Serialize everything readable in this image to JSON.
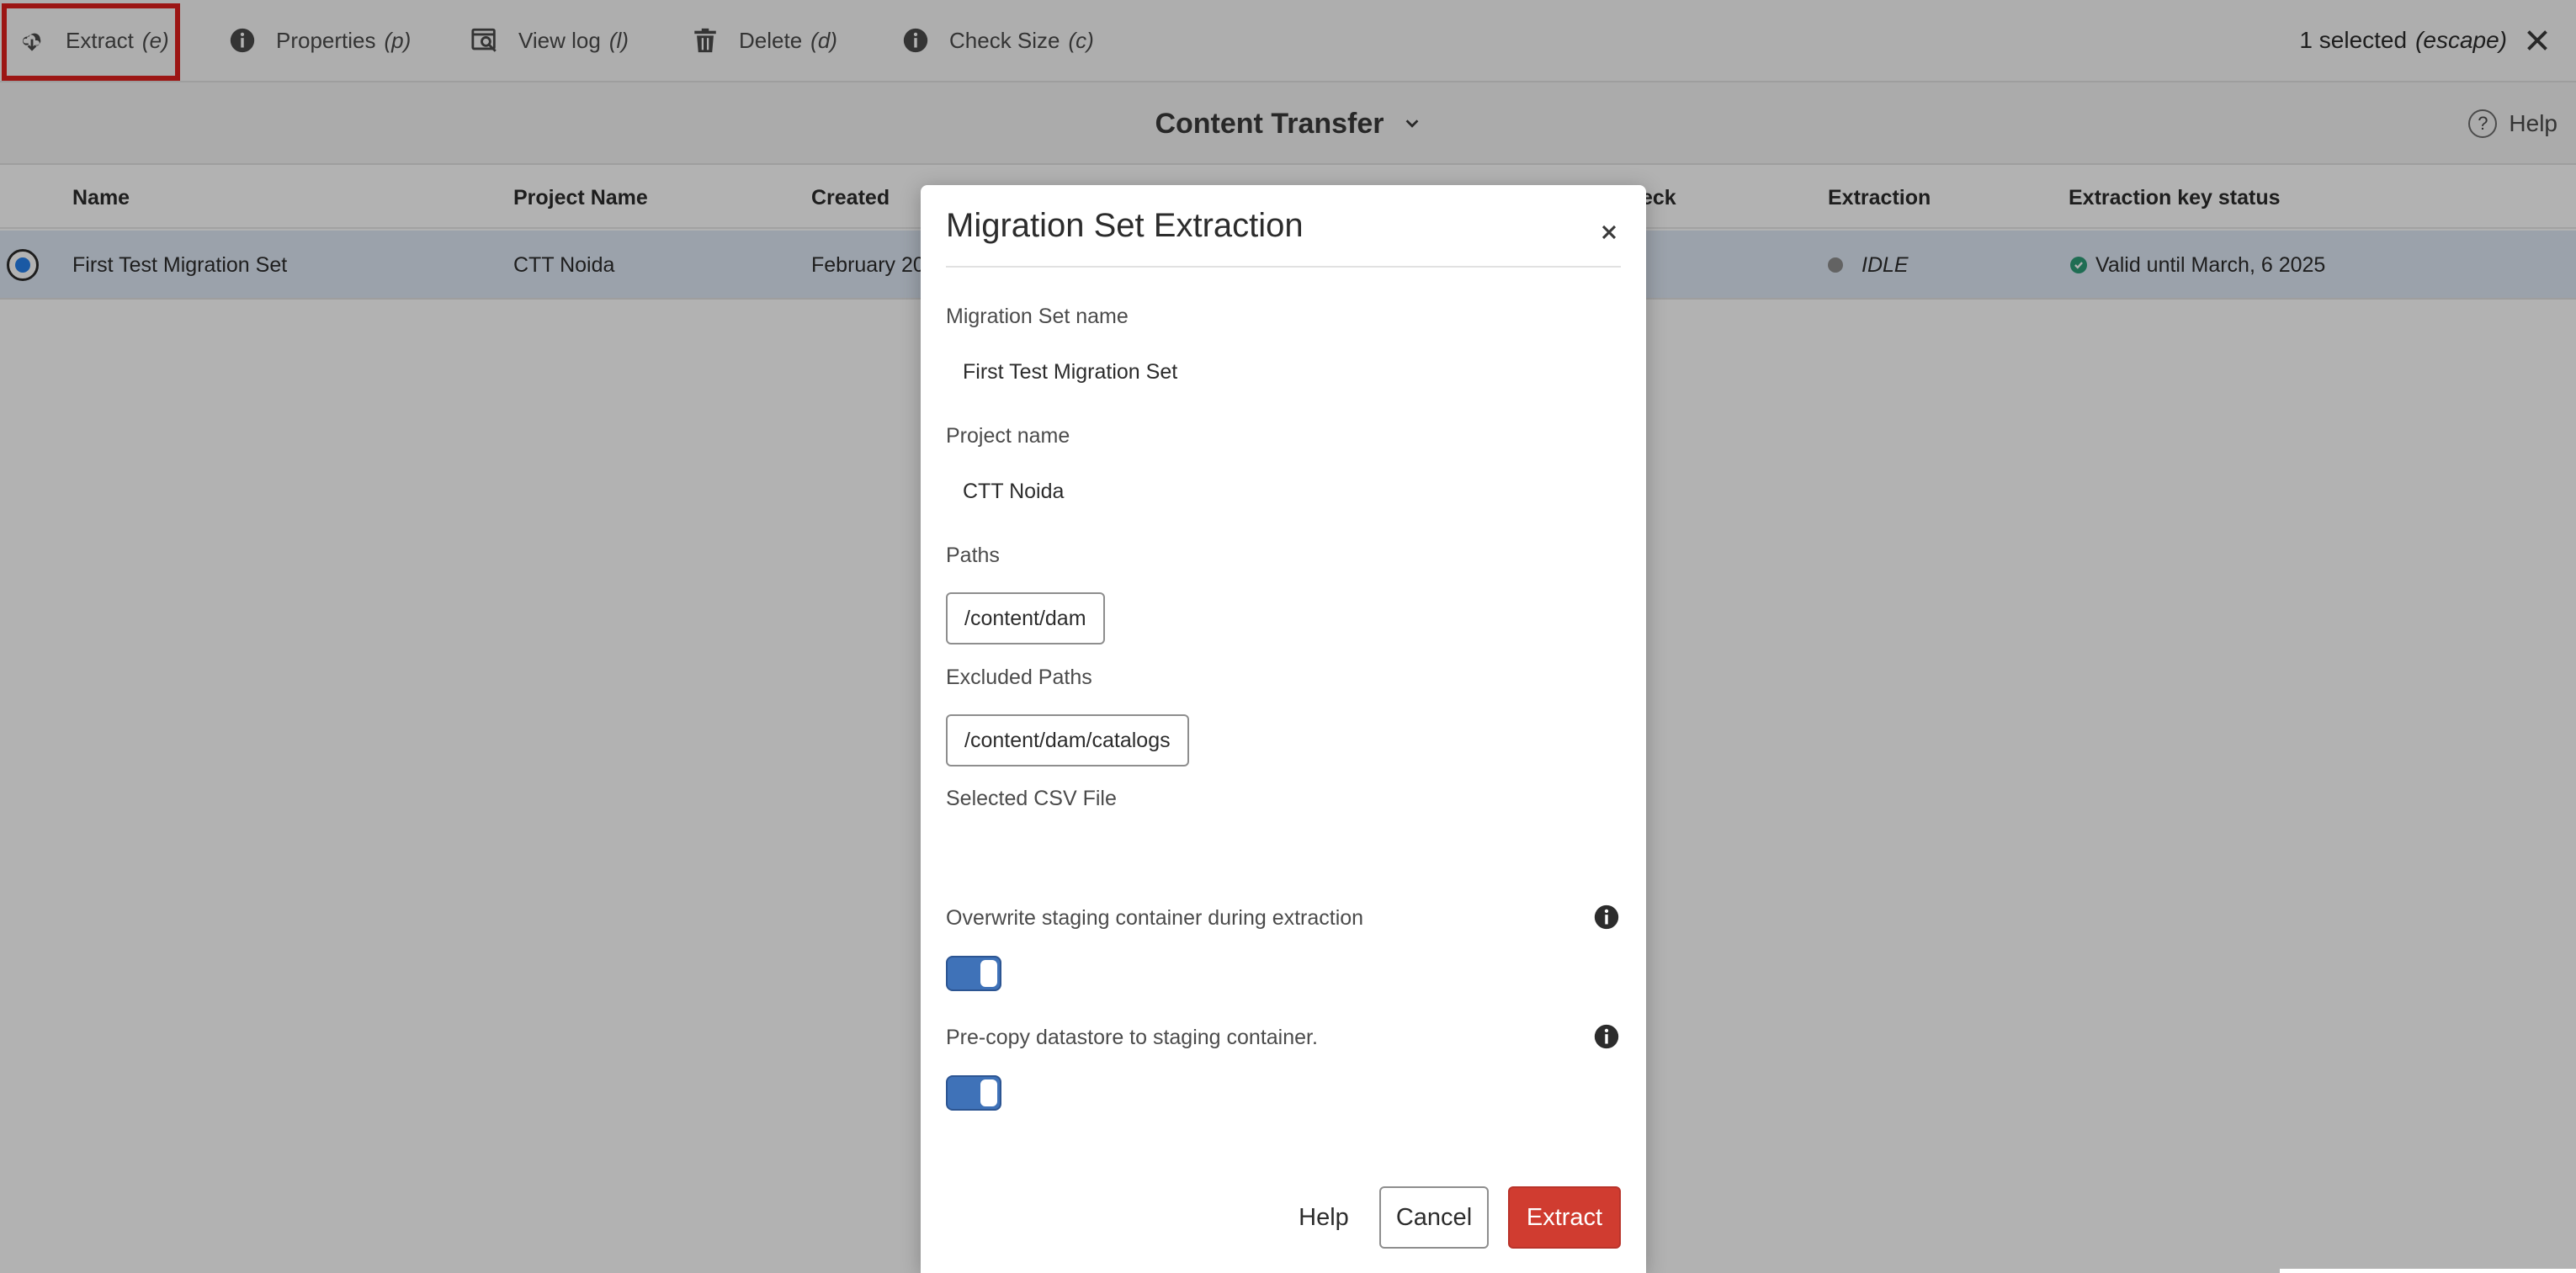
{
  "action_bar": {
    "extract": {
      "label": "Extract",
      "key": "(e)"
    },
    "properties": {
      "label": "Properties",
      "key": "(p)"
    },
    "view_log": {
      "label": "View log",
      "key": "(l)"
    },
    "delete": {
      "label": "Delete",
      "key": "(d)"
    },
    "check_size": {
      "label": "Check Size",
      "key": "(c)"
    },
    "selected": {
      "label": "1 selected",
      "key": "(escape)"
    }
  },
  "title_bar": {
    "title": "Content Transfer",
    "help": "Help"
  },
  "table": {
    "headers": {
      "name": "Name",
      "project_name": "Project Name",
      "created": "Created",
      "check": "eck",
      "extraction": "Extraction",
      "extraction_key_status": "Extraction key status"
    },
    "row": {
      "name": "First Test Migration Set",
      "project_name": "CTT Noida",
      "created": "February 20",
      "extraction": "IDLE",
      "extraction_key_status": "Valid until March, 6 2025"
    }
  },
  "dialog": {
    "title": "Migration Set Extraction",
    "migration_set_name_label": "Migration Set name",
    "migration_set_name_value": "First Test Migration Set",
    "project_name_label": "Project name",
    "project_name_value": "CTT Noida",
    "paths_label": "Paths",
    "paths": [
      "/content/dam"
    ],
    "excluded_paths_label": "Excluded Paths",
    "excluded_paths": [
      "/content/dam/catalogs"
    ],
    "csv_label": "Selected CSV File",
    "overwrite_label": "Overwrite staging container during extraction",
    "overwrite_on": true,
    "precopy_label": "Pre-copy datastore to staging container.",
    "precopy_on": true,
    "help_button": "Help",
    "cancel_button": "Cancel",
    "extract_button": "Extract"
  },
  "colors": {
    "highlight": "#e0201d",
    "primary_button": "#d03c30",
    "toggle_on": "#3f72b8",
    "selected_row": "#dfe8f5",
    "valid": "#2d9d78",
    "idle": "#8e8e8e"
  },
  "icons": {
    "extract": "cloud-download-icon",
    "properties": "info-icon",
    "view_log": "view-log-icon",
    "delete": "trash-icon",
    "check_size": "info-icon",
    "close": "close-icon",
    "chevron": "chevron-down-icon",
    "help": "help-circle-icon"
  }
}
